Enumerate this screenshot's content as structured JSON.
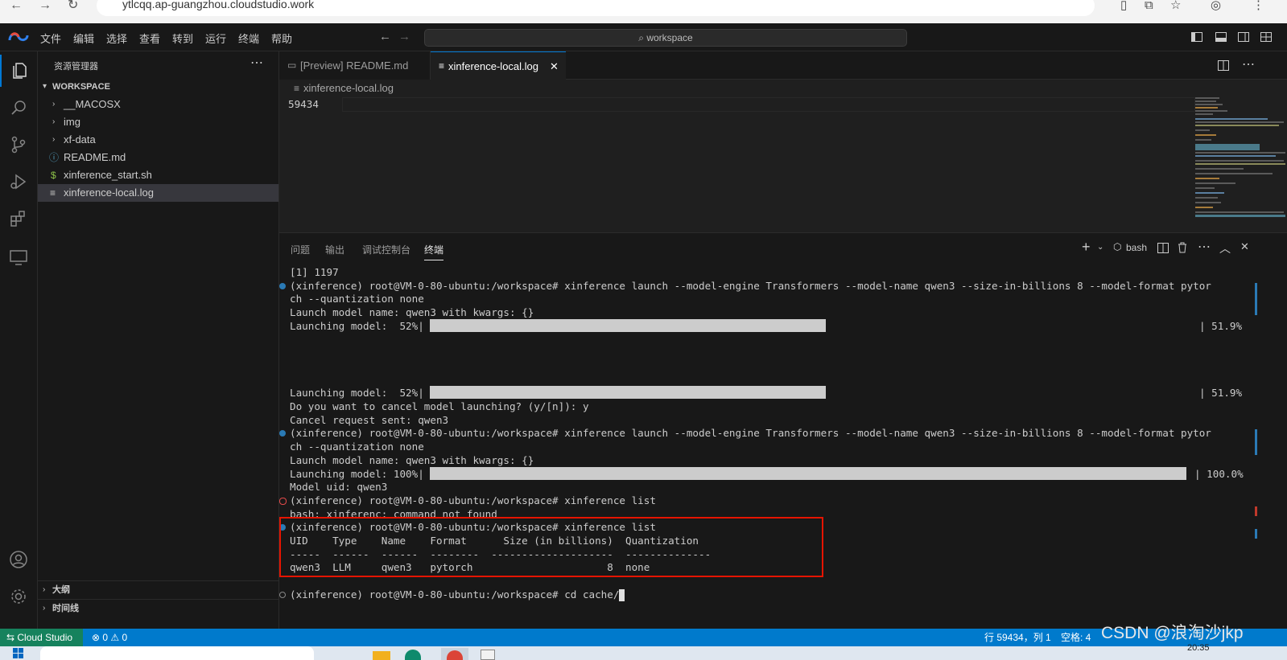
{
  "browser": {
    "url": "ytlcqq.ap-guangzhou.cloudstudio.work"
  },
  "menubar": {
    "items": [
      "文件",
      "编辑",
      "选择",
      "查看",
      "转到",
      "运行",
      "终端",
      "帮助"
    ],
    "search": "workspace"
  },
  "sidebar": {
    "title": "资源管理器",
    "workspace": "WORKSPACE",
    "items": [
      {
        "label": "__MACOSX",
        "type": "folder"
      },
      {
        "label": "img",
        "type": "folder"
      },
      {
        "label": "xf-data",
        "type": "folder"
      },
      {
        "label": "README.md",
        "type": "file-info"
      },
      {
        "label": "xinference_start.sh",
        "type": "file-shell"
      },
      {
        "label": "xinference-local.log",
        "type": "file-log",
        "selected": true
      }
    ],
    "outline": "大纲",
    "timeline": "时间线"
  },
  "editor": {
    "tabs": [
      {
        "label": "[Preview] README.md",
        "active": false
      },
      {
        "label": "xinference-local.log",
        "active": true
      }
    ],
    "breadcrumb": "xinference-local.log",
    "line_number": "59434"
  },
  "panel": {
    "tabs": [
      "问题",
      "输出",
      "调试控制台",
      "终端"
    ],
    "active_tab": "终端",
    "shell": "bash",
    "terminal_lines": [
      {
        "text": "[1] 1197"
      },
      {
        "text": "(xinference) root@VM-0-80-ubuntu:/workspace# xinference launch --model-engine Transformers --model-name qwen3 --size-in-billions 8 --model-format pytor",
        "dot": "blue"
      },
      {
        "text": "ch --quantization none"
      },
      {
        "text": "Launch model name: qwen3 with kwargs: {}"
      },
      {
        "text": "Launching model:  52%|",
        "bar": 0.52,
        "suffix": "| 51.9%"
      },
      {
        "text": ""
      },
      {
        "text": ""
      },
      {
        "text": ""
      },
      {
        "text": ""
      },
      {
        "text": "Launching model:  52%|",
        "bar": 0.52,
        "suffix": "| 51.9%"
      },
      {
        "text": "Do you want to cancel model launching? (y/[n]): y"
      },
      {
        "text": "Cancel request sent: qwen3"
      },
      {
        "text": "(xinference) root@VM-0-80-ubuntu:/workspace# xinference launch --model-engine Transformers --model-name qwen3 --size-in-billions 8 --model-format pytor",
        "dot": "blue"
      },
      {
        "text": "ch --quantization none"
      },
      {
        "text": "Launch model name: qwen3 with kwargs: {}"
      },
      {
        "text": "Launching model: 100%|",
        "bar": 1.0,
        "suffix": "| 100.0%"
      },
      {
        "text": "Model uid: qwen3"
      },
      {
        "text": "(xinference) root@VM-0-80-ubuntu:/workspace# xinference list",
        "dot": "error"
      },
      {
        "text": "bash: xinferenc: command not found"
      },
      {
        "text": "(xinference) root@VM-0-80-ubuntu:/workspace# xinference list",
        "dot": "blue"
      },
      {
        "text": "UID    Type    Name    Format      Size (in billions)  Quantization"
      },
      {
        "text": "-----  ------  ------  --------  --------------------  --------------"
      },
      {
        "text": "qwen3  LLM     qwen3   pytorch                      8  none"
      },
      {
        "text": ""
      },
      {
        "text": "(xinference) root@VM-0-80-ubuntu:/workspace# cd cache/",
        "dot": "hollow",
        "cursor": true
      }
    ]
  },
  "statusbar": {
    "remote": "Cloud Studio",
    "errors": "0",
    "warnings": "0",
    "position": "行 59434，列 1",
    "spaces": "空格: 4",
    "watermark": "CSDN @浪淘沙jkp",
    "time": "20:35"
  },
  "colors": {
    "accent": "#007acc",
    "remote": "#16825d",
    "highlight_box": "#e51400"
  }
}
